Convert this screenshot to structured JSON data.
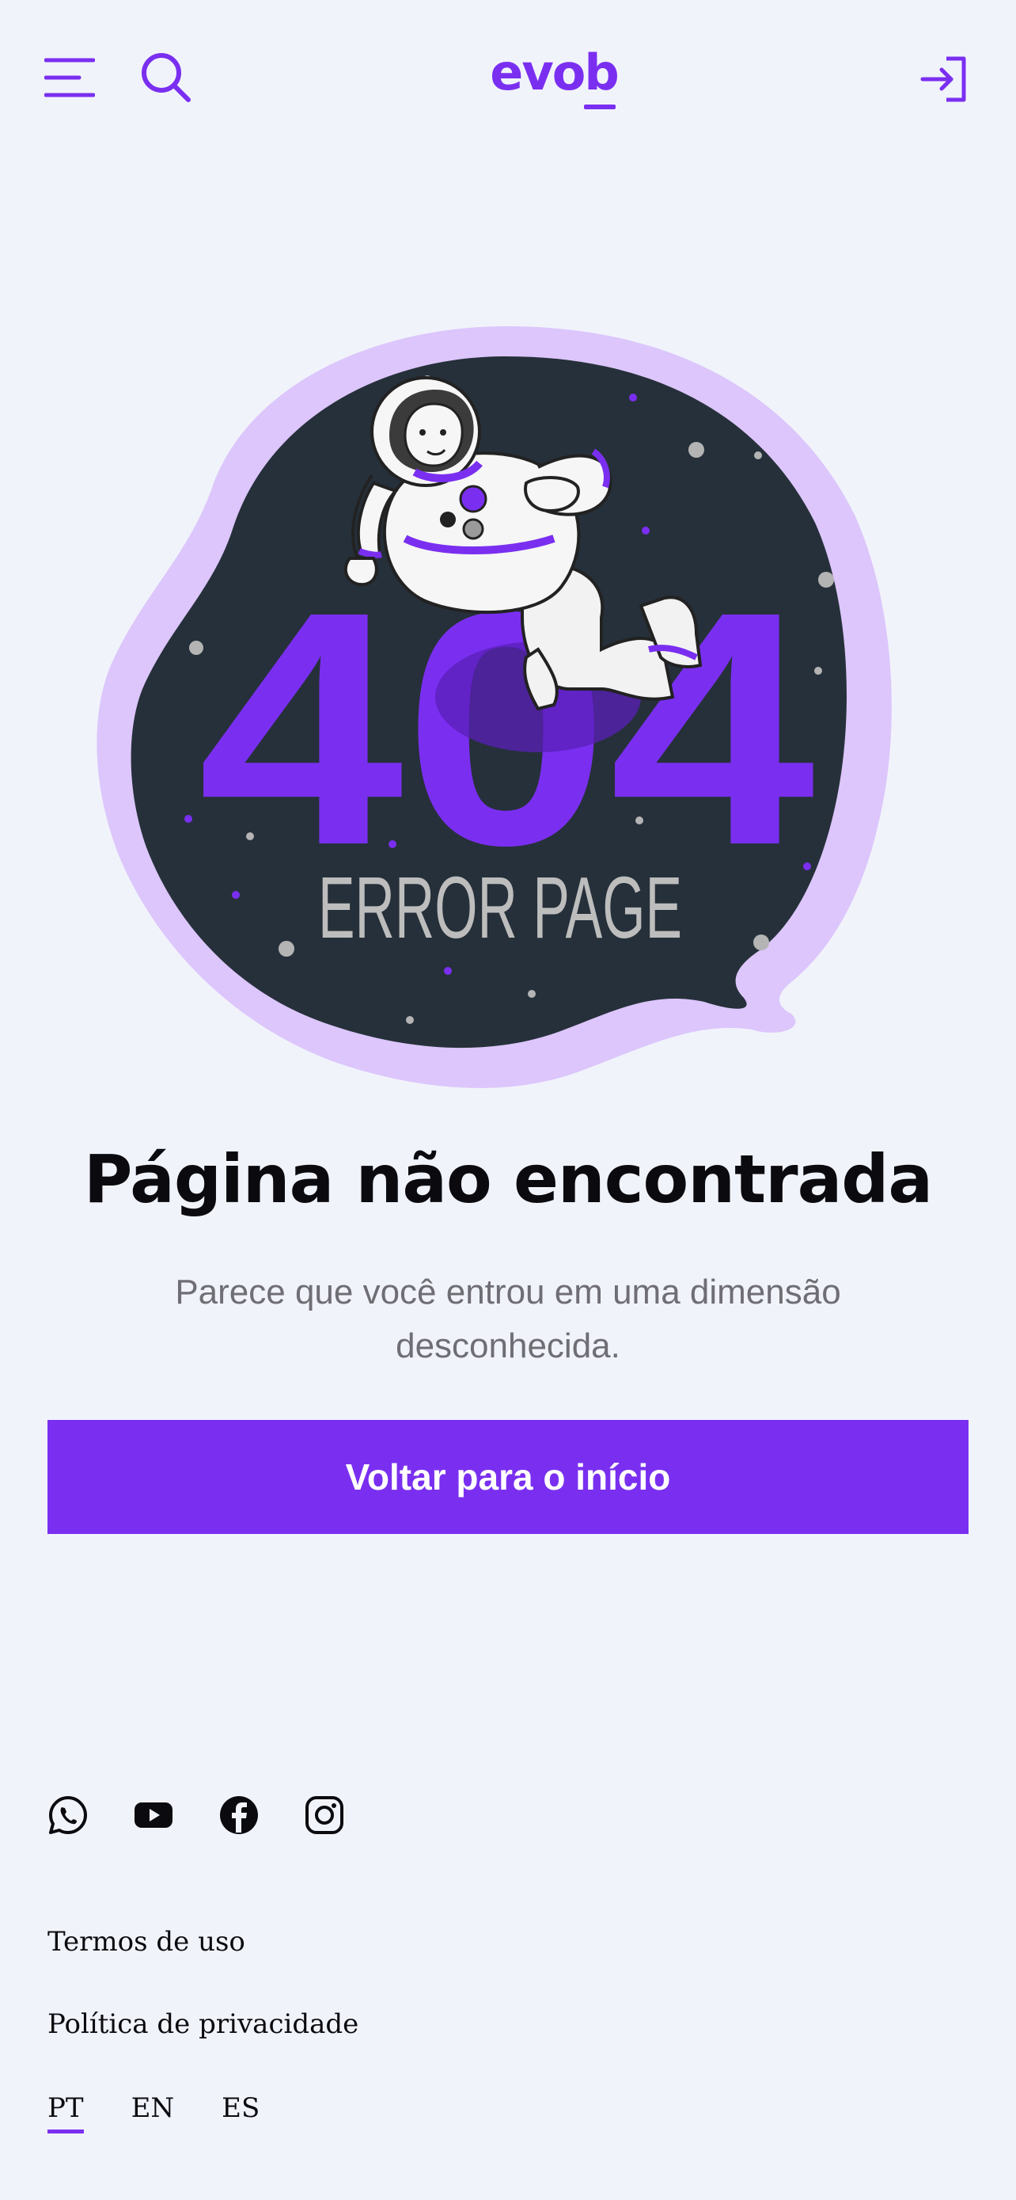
{
  "header": {
    "logo_text": "evob",
    "menu_icon": "menu-icon",
    "search_icon": "search-icon",
    "login_icon": "login-icon"
  },
  "illustration": {
    "big_text": "404",
    "caption": "ERROR PAGE"
  },
  "main": {
    "title": "Página não encontrada",
    "subtitle": "Parece que você entrou em uma dimensão desconhecida.",
    "cta_label": "Voltar para o início"
  },
  "footer": {
    "social": [
      "whatsapp-icon",
      "youtube-icon",
      "facebook-icon",
      "instagram-icon"
    ],
    "links": {
      "terms": "Termos de uso",
      "privacy": "Política de privacidade"
    },
    "languages": [
      "PT",
      "EN",
      "ES"
    ],
    "active_language": "PT"
  },
  "colors": {
    "accent": "#7a2ff0",
    "background": "#f1f3fb",
    "blob_dark": "#26303a",
    "blob_light": "#dcc6fb"
  }
}
